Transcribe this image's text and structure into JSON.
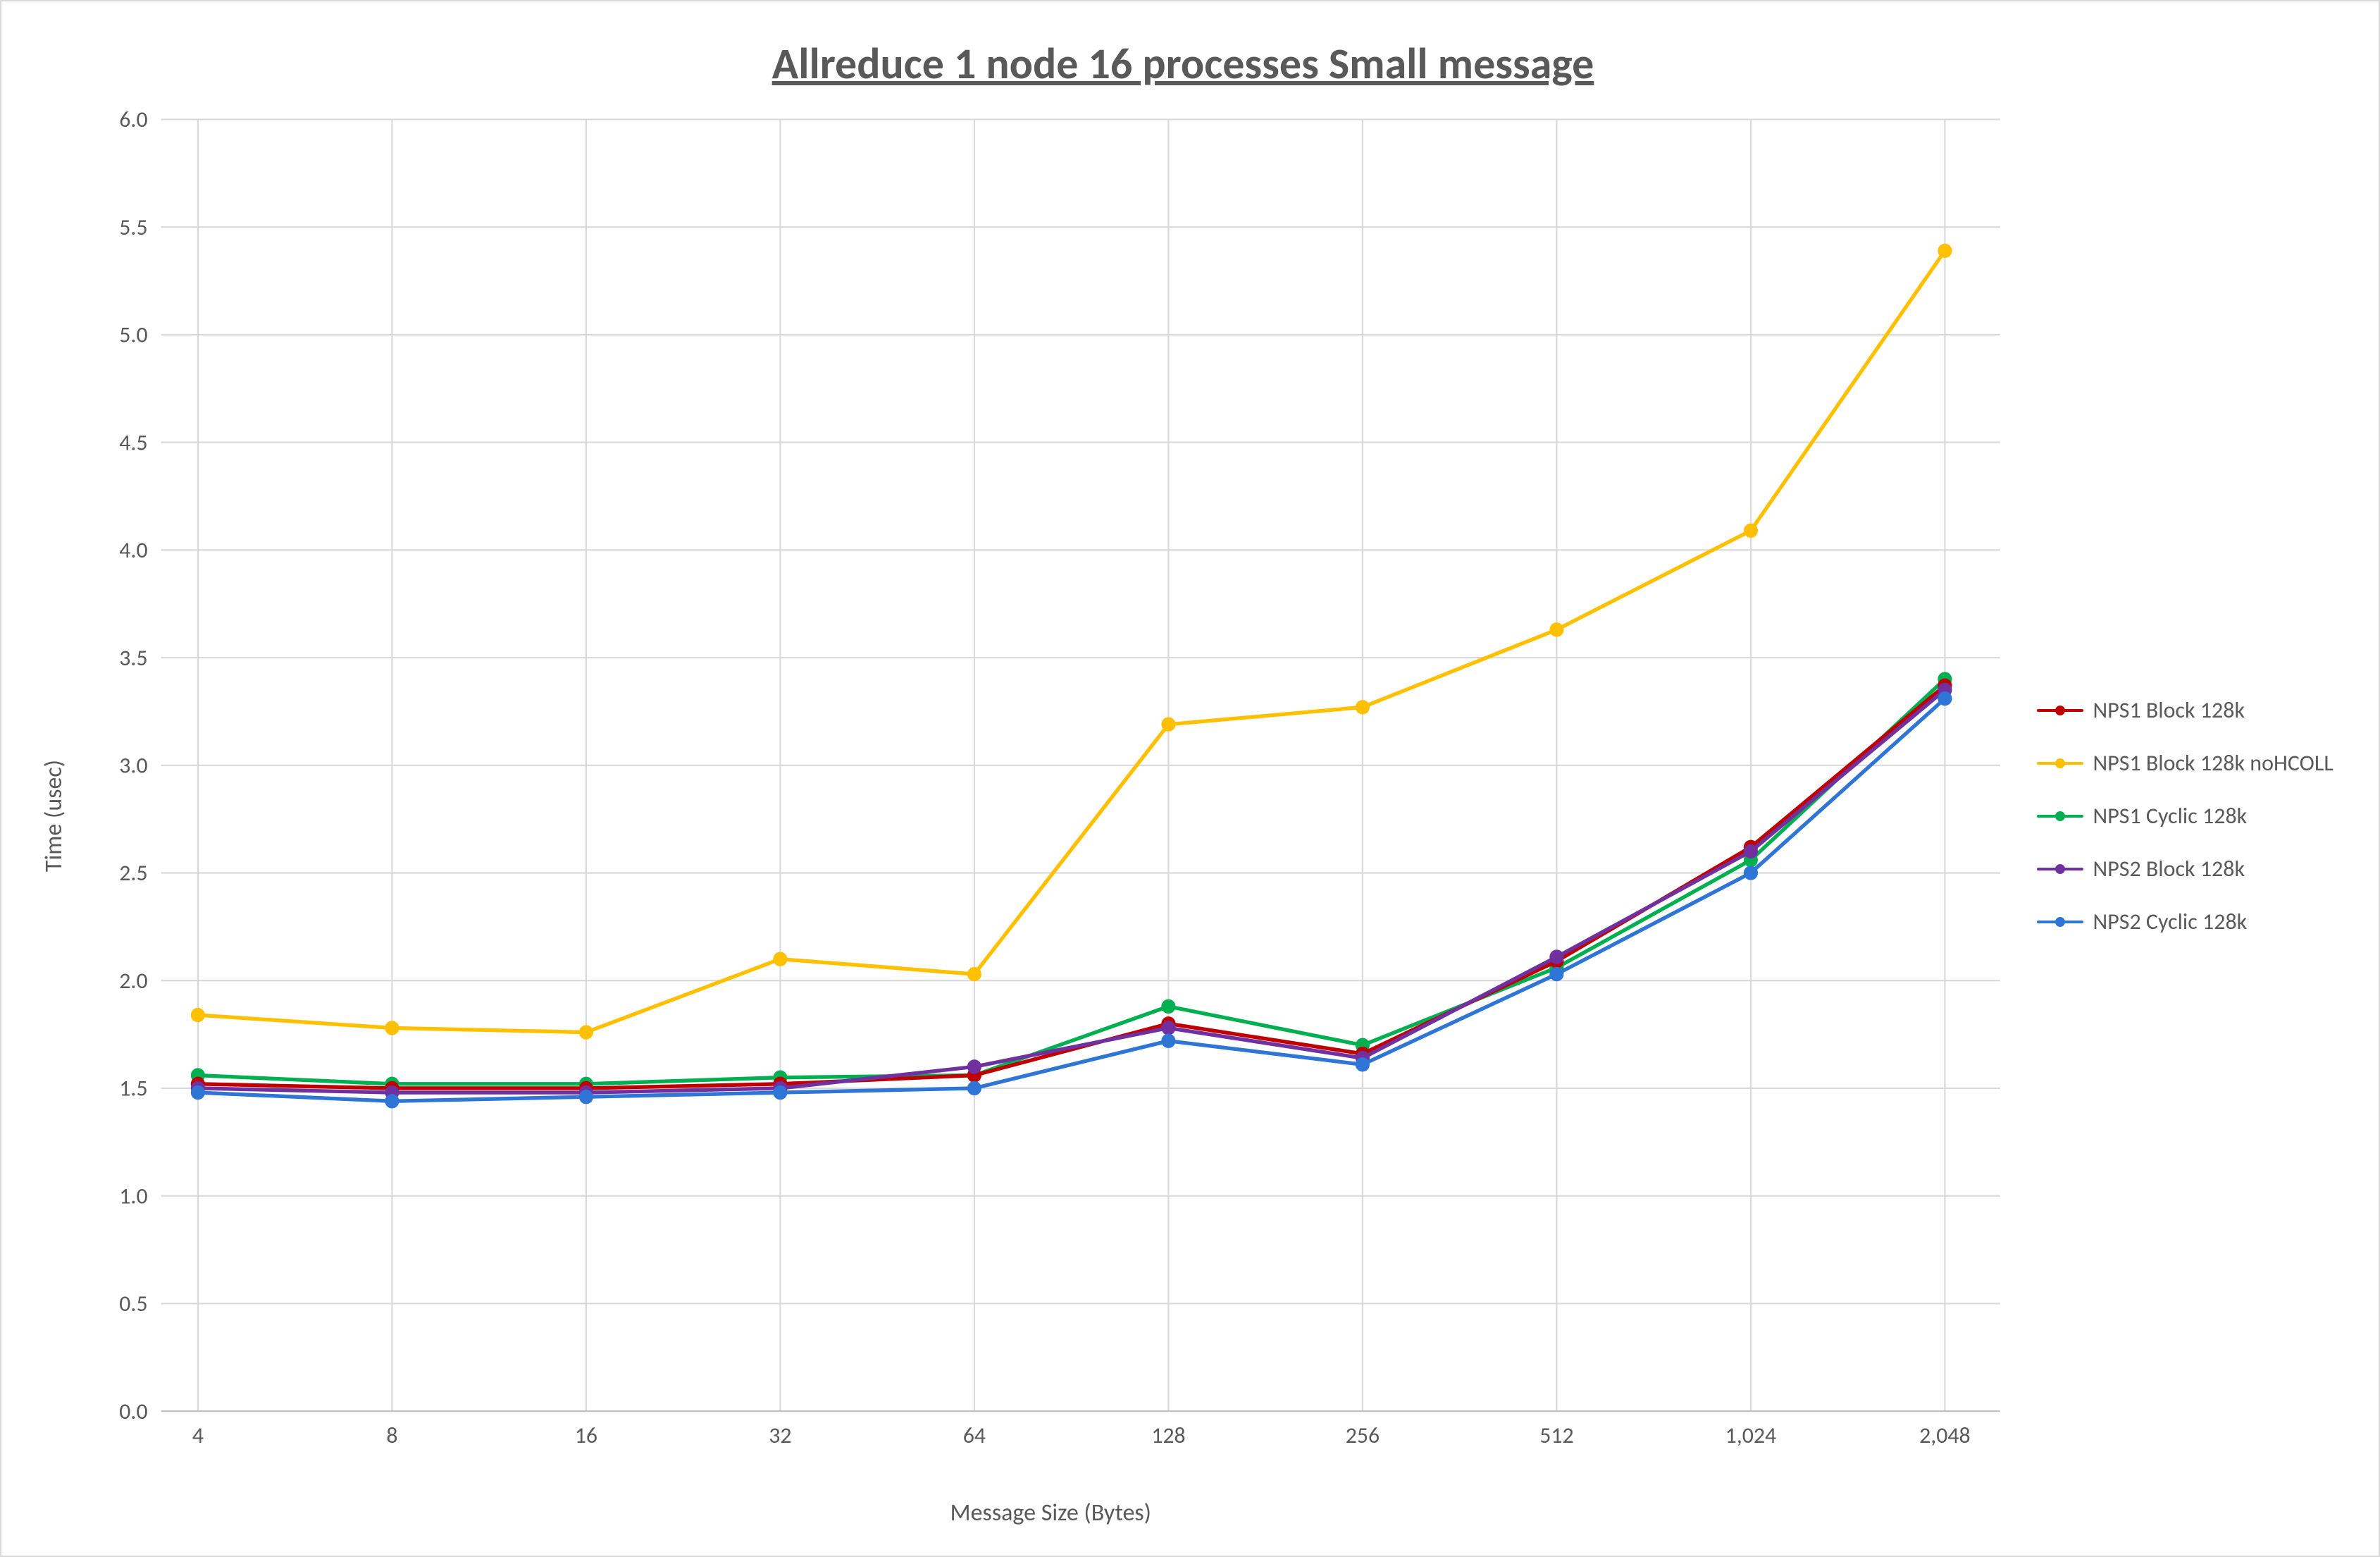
{
  "chart_data": {
    "type": "line",
    "title": "Allreduce 1 node 16 processes Small message",
    "xlabel": "Message Size (Bytes)",
    "ylabel": "Time (usec)",
    "ylim": [
      0.0,
      6.0
    ],
    "ytick_step": 0.5,
    "categories": [
      4,
      8,
      16,
      32,
      64,
      128,
      256,
      512,
      1024,
      2048
    ],
    "x_tick_labels": [
      "4",
      "8",
      "16",
      "32",
      "64",
      "128",
      "256",
      "512",
      "1,024",
      "2,048"
    ],
    "series": [
      {
        "name": "NPS1 Block 128k",
        "color": "#c00000",
        "values": [
          1.52,
          1.5,
          1.5,
          1.52,
          1.56,
          1.8,
          1.66,
          2.09,
          2.62,
          3.37
        ]
      },
      {
        "name": "NPS1 Block 128k noHCOLL",
        "color": "#ffc000",
        "values": [
          1.84,
          1.78,
          1.76,
          2.1,
          2.03,
          3.19,
          3.27,
          3.63,
          4.09,
          5.39
        ]
      },
      {
        "name": "NPS1 Cyclic 128k",
        "color": "#00b050",
        "values": [
          1.56,
          1.52,
          1.52,
          1.55,
          1.56,
          1.88,
          1.7,
          2.06,
          2.56,
          3.4
        ]
      },
      {
        "name": "NPS2 Block 128k",
        "color": "#7030a0",
        "values": [
          1.5,
          1.48,
          1.48,
          1.5,
          1.6,
          1.78,
          1.64,
          2.11,
          2.6,
          3.35
        ]
      },
      {
        "name": "NPS2 Cyclic 128k",
        "color": "#2e75d6",
        "values": [
          1.48,
          1.44,
          1.46,
          1.48,
          1.5,
          1.72,
          1.61,
          2.03,
          2.5,
          3.31
        ]
      }
    ]
  }
}
